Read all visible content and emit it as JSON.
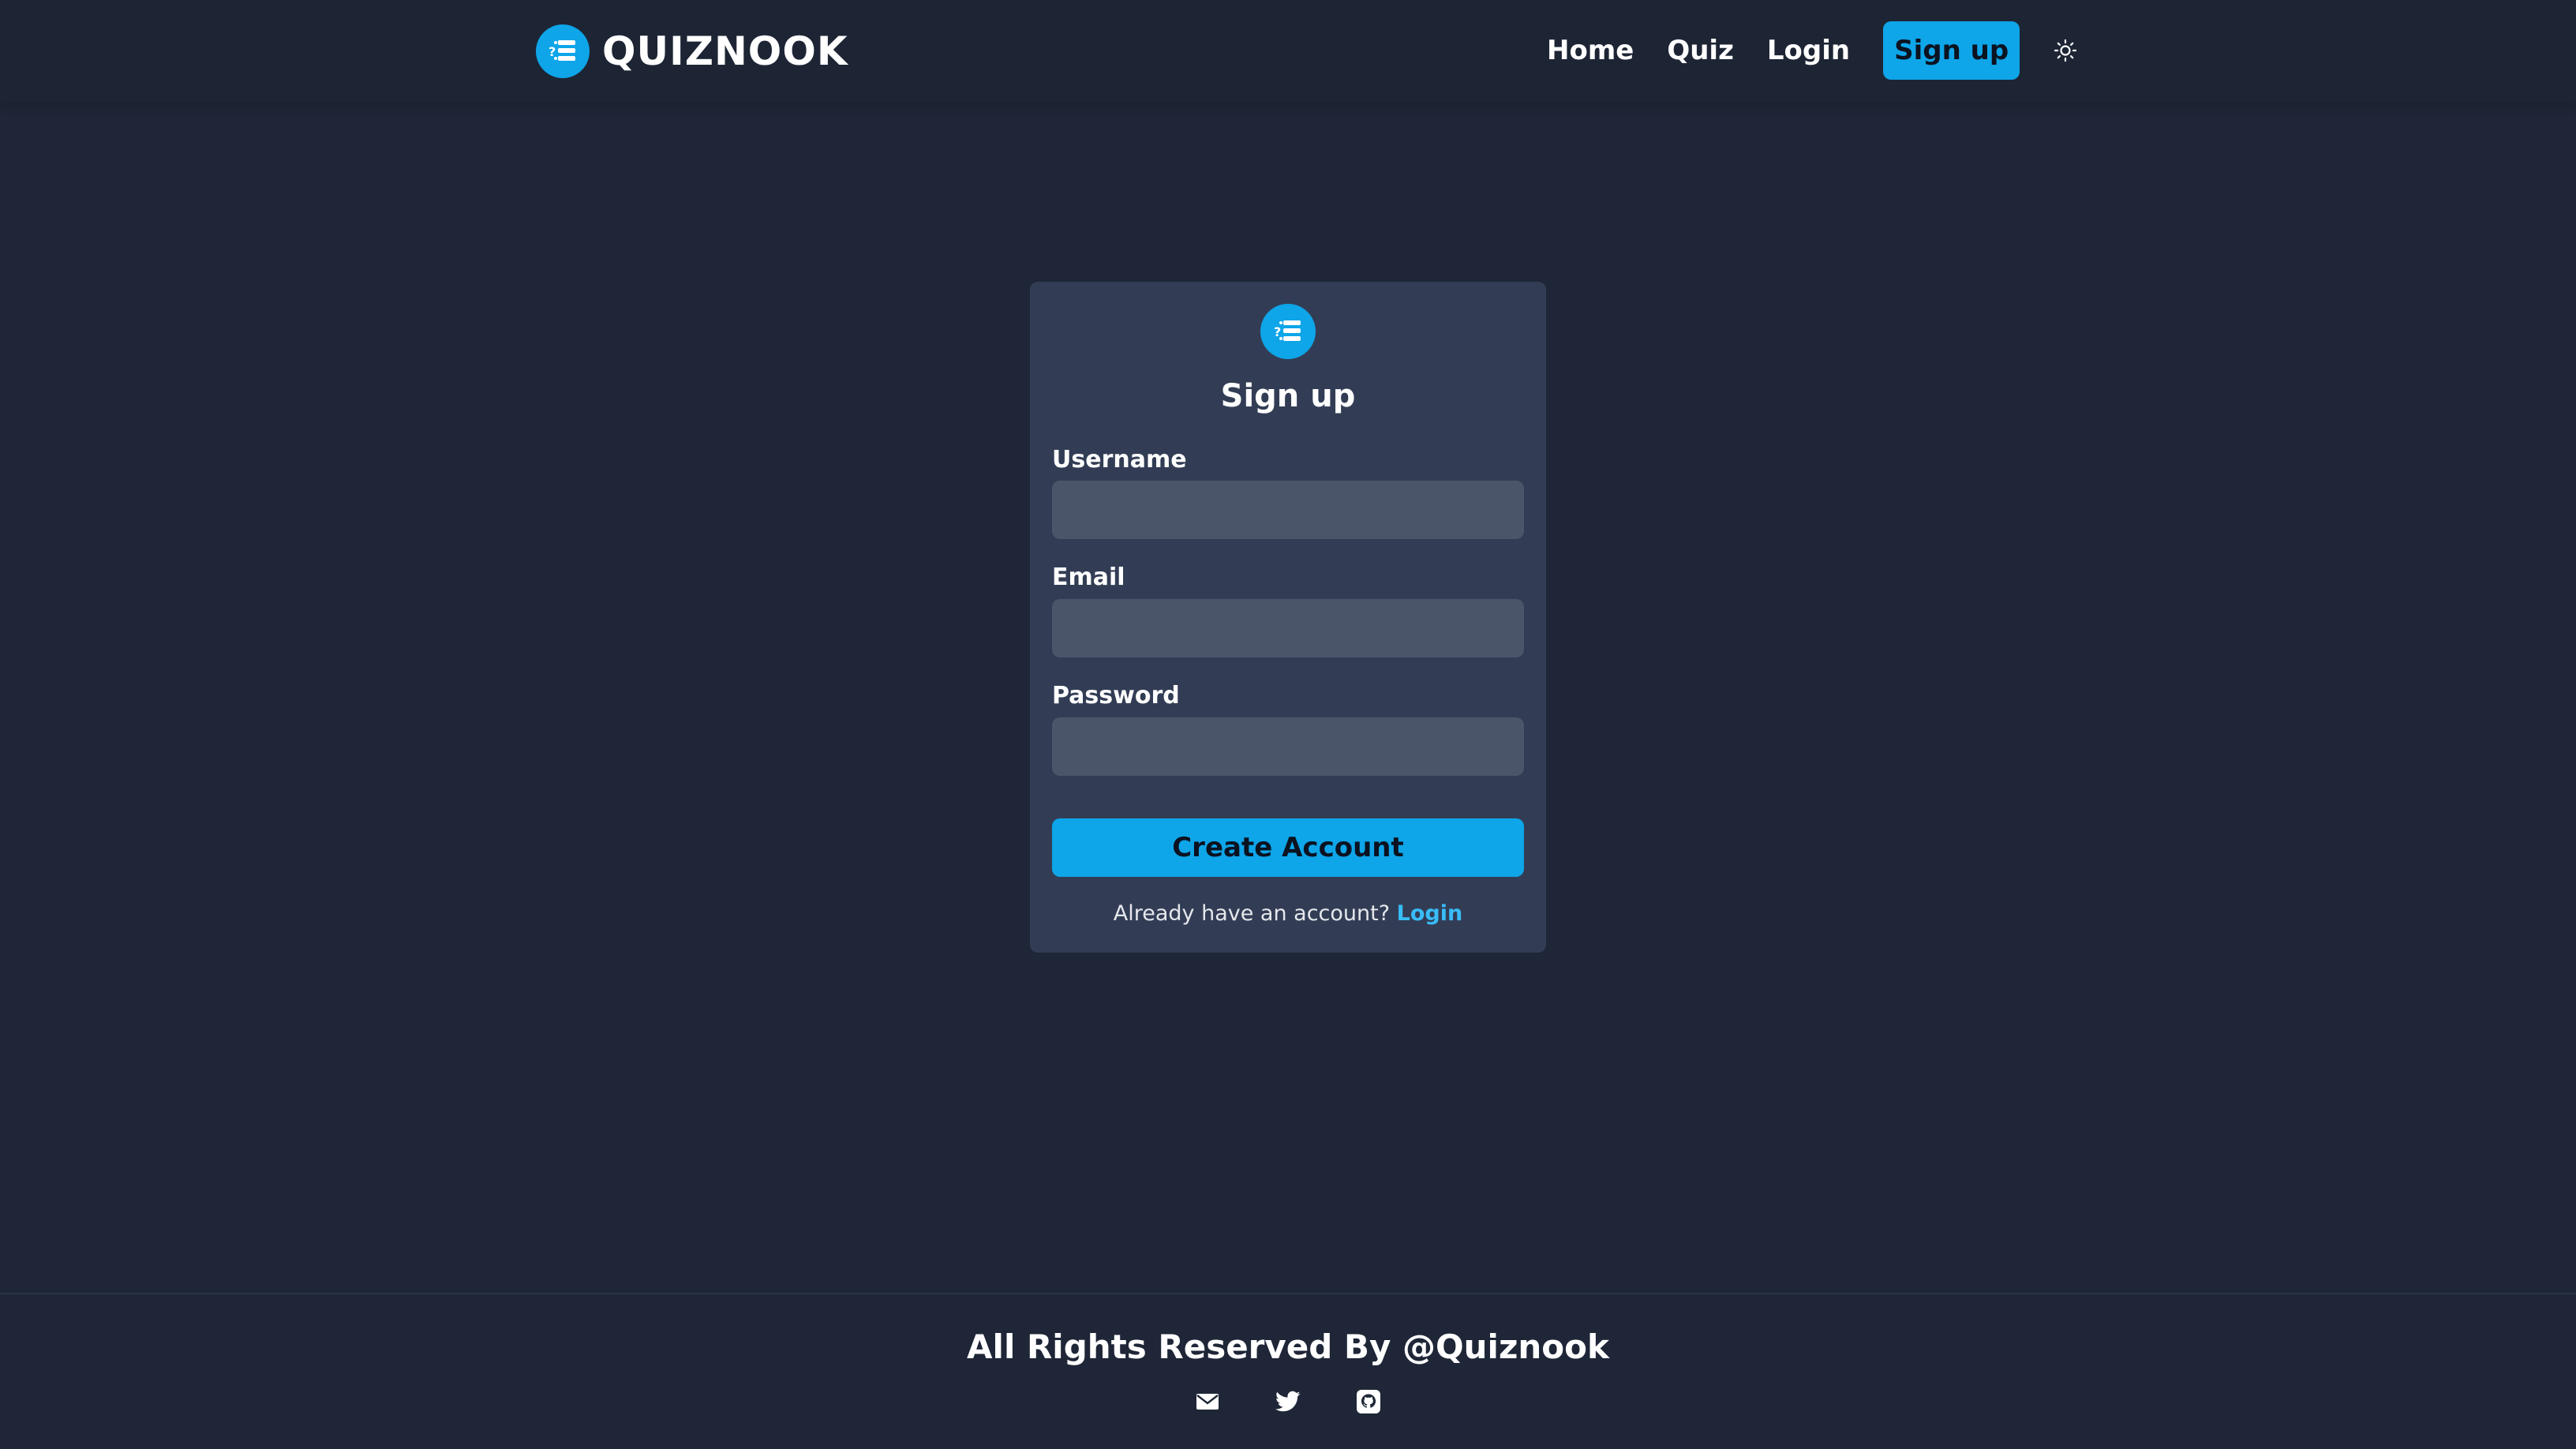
{
  "header": {
    "brand": "QUIZNOOK",
    "logo_icon": "quiz-list-icon",
    "nav": [
      {
        "label": "Home"
      },
      {
        "label": "Quiz"
      },
      {
        "label": "Login"
      }
    ],
    "signup_label": "Sign up",
    "theme_icon": "sun-icon"
  },
  "form": {
    "logo_icon": "quiz-list-icon",
    "title": "Sign up",
    "fields": [
      {
        "label": "Username",
        "value": "",
        "placeholder": ""
      },
      {
        "label": "Email",
        "value": "",
        "placeholder": ""
      },
      {
        "label": "Password",
        "value": "",
        "placeholder": ""
      }
    ],
    "submit_label": "Create Account",
    "login_prompt": "Already have an account?",
    "login_link": "Login"
  },
  "footer": {
    "text": "All Rights Reserved By @Quiznook",
    "icons": [
      "mail-icon",
      "twitter-icon",
      "github-icon"
    ]
  },
  "colors": {
    "background": "#1e2637",
    "card": "#323d55",
    "input": "#4a5569",
    "accent": "#0ea5e9",
    "link": "#38bdf8"
  }
}
